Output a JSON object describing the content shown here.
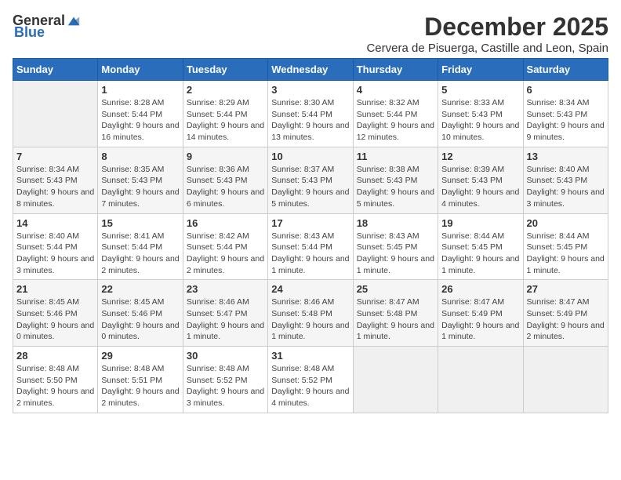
{
  "logo": {
    "general": "General",
    "blue": "Blue"
  },
  "title": "December 2025",
  "subtitle": "Cervera de Pisuerga, Castille and Leon, Spain",
  "weekdays": [
    "Sunday",
    "Monday",
    "Tuesday",
    "Wednesday",
    "Thursday",
    "Friday",
    "Saturday"
  ],
  "weeks": [
    [
      {
        "day": "",
        "sunrise": "",
        "sunset": "",
        "daylight": "",
        "empty": true
      },
      {
        "day": "1",
        "sunrise": "Sunrise: 8:28 AM",
        "sunset": "Sunset: 5:44 PM",
        "daylight": "Daylight: 9 hours and 16 minutes."
      },
      {
        "day": "2",
        "sunrise": "Sunrise: 8:29 AM",
        "sunset": "Sunset: 5:44 PM",
        "daylight": "Daylight: 9 hours and 14 minutes."
      },
      {
        "day": "3",
        "sunrise": "Sunrise: 8:30 AM",
        "sunset": "Sunset: 5:44 PM",
        "daylight": "Daylight: 9 hours and 13 minutes."
      },
      {
        "day": "4",
        "sunrise": "Sunrise: 8:32 AM",
        "sunset": "Sunset: 5:44 PM",
        "daylight": "Daylight: 9 hours and 12 minutes."
      },
      {
        "day": "5",
        "sunrise": "Sunrise: 8:33 AM",
        "sunset": "Sunset: 5:43 PM",
        "daylight": "Daylight: 9 hours and 10 minutes."
      },
      {
        "day": "6",
        "sunrise": "Sunrise: 8:34 AM",
        "sunset": "Sunset: 5:43 PM",
        "daylight": "Daylight: 9 hours and 9 minutes."
      }
    ],
    [
      {
        "day": "7",
        "sunrise": "Sunrise: 8:34 AM",
        "sunset": "Sunset: 5:43 PM",
        "daylight": "Daylight: 9 hours and 8 minutes."
      },
      {
        "day": "8",
        "sunrise": "Sunrise: 8:35 AM",
        "sunset": "Sunset: 5:43 PM",
        "daylight": "Daylight: 9 hours and 7 minutes."
      },
      {
        "day": "9",
        "sunrise": "Sunrise: 8:36 AM",
        "sunset": "Sunset: 5:43 PM",
        "daylight": "Daylight: 9 hours and 6 minutes."
      },
      {
        "day": "10",
        "sunrise": "Sunrise: 8:37 AM",
        "sunset": "Sunset: 5:43 PM",
        "daylight": "Daylight: 9 hours and 5 minutes."
      },
      {
        "day": "11",
        "sunrise": "Sunrise: 8:38 AM",
        "sunset": "Sunset: 5:43 PM",
        "daylight": "Daylight: 9 hours and 5 minutes."
      },
      {
        "day": "12",
        "sunrise": "Sunrise: 8:39 AM",
        "sunset": "Sunset: 5:43 PM",
        "daylight": "Daylight: 9 hours and 4 minutes."
      },
      {
        "day": "13",
        "sunrise": "Sunrise: 8:40 AM",
        "sunset": "Sunset: 5:43 PM",
        "daylight": "Daylight: 9 hours and 3 minutes."
      }
    ],
    [
      {
        "day": "14",
        "sunrise": "Sunrise: 8:40 AM",
        "sunset": "Sunset: 5:44 PM",
        "daylight": "Daylight: 9 hours and 3 minutes."
      },
      {
        "day": "15",
        "sunrise": "Sunrise: 8:41 AM",
        "sunset": "Sunset: 5:44 PM",
        "daylight": "Daylight: 9 hours and 2 minutes."
      },
      {
        "day": "16",
        "sunrise": "Sunrise: 8:42 AM",
        "sunset": "Sunset: 5:44 PM",
        "daylight": "Daylight: 9 hours and 2 minutes."
      },
      {
        "day": "17",
        "sunrise": "Sunrise: 8:43 AM",
        "sunset": "Sunset: 5:44 PM",
        "daylight": "Daylight: 9 hours and 1 minute."
      },
      {
        "day": "18",
        "sunrise": "Sunrise: 8:43 AM",
        "sunset": "Sunset: 5:45 PM",
        "daylight": "Daylight: 9 hours and 1 minute."
      },
      {
        "day": "19",
        "sunrise": "Sunrise: 8:44 AM",
        "sunset": "Sunset: 5:45 PM",
        "daylight": "Daylight: 9 hours and 1 minute."
      },
      {
        "day": "20",
        "sunrise": "Sunrise: 8:44 AM",
        "sunset": "Sunset: 5:45 PM",
        "daylight": "Daylight: 9 hours and 1 minute."
      }
    ],
    [
      {
        "day": "21",
        "sunrise": "Sunrise: 8:45 AM",
        "sunset": "Sunset: 5:46 PM",
        "daylight": "Daylight: 9 hours and 0 minutes."
      },
      {
        "day": "22",
        "sunrise": "Sunrise: 8:45 AM",
        "sunset": "Sunset: 5:46 PM",
        "daylight": "Daylight: 9 hours and 0 minutes."
      },
      {
        "day": "23",
        "sunrise": "Sunrise: 8:46 AM",
        "sunset": "Sunset: 5:47 PM",
        "daylight": "Daylight: 9 hours and 1 minute."
      },
      {
        "day": "24",
        "sunrise": "Sunrise: 8:46 AM",
        "sunset": "Sunset: 5:48 PM",
        "daylight": "Daylight: 9 hours and 1 minute."
      },
      {
        "day": "25",
        "sunrise": "Sunrise: 8:47 AM",
        "sunset": "Sunset: 5:48 PM",
        "daylight": "Daylight: 9 hours and 1 minute."
      },
      {
        "day": "26",
        "sunrise": "Sunrise: 8:47 AM",
        "sunset": "Sunset: 5:49 PM",
        "daylight": "Daylight: 9 hours and 1 minute."
      },
      {
        "day": "27",
        "sunrise": "Sunrise: 8:47 AM",
        "sunset": "Sunset: 5:49 PM",
        "daylight": "Daylight: 9 hours and 2 minutes."
      }
    ],
    [
      {
        "day": "28",
        "sunrise": "Sunrise: 8:48 AM",
        "sunset": "Sunset: 5:50 PM",
        "daylight": "Daylight: 9 hours and 2 minutes."
      },
      {
        "day": "29",
        "sunrise": "Sunrise: 8:48 AM",
        "sunset": "Sunset: 5:51 PM",
        "daylight": "Daylight: 9 hours and 2 minutes."
      },
      {
        "day": "30",
        "sunrise": "Sunrise: 8:48 AM",
        "sunset": "Sunset: 5:52 PM",
        "daylight": "Daylight: 9 hours and 3 minutes."
      },
      {
        "day": "31",
        "sunrise": "Sunrise: 8:48 AM",
        "sunset": "Sunset: 5:52 PM",
        "daylight": "Daylight: 9 hours and 4 minutes."
      },
      {
        "day": "",
        "sunrise": "",
        "sunset": "",
        "daylight": "",
        "empty": true
      },
      {
        "day": "",
        "sunrise": "",
        "sunset": "",
        "daylight": "",
        "empty": true
      },
      {
        "day": "",
        "sunrise": "",
        "sunset": "",
        "daylight": "",
        "empty": true
      }
    ]
  ]
}
